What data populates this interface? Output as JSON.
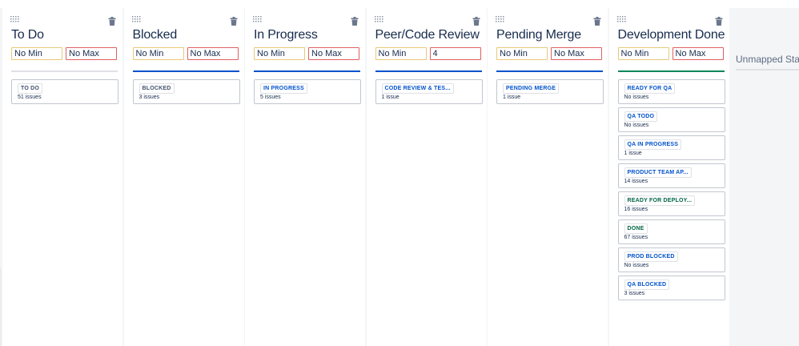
{
  "colors": {
    "board_bg": "#f4f5f7",
    "column_bg": "#ffffff",
    "bar_grey": "#dfe1e6",
    "bar_blue": "#0052cc",
    "bar_green": "#00875a",
    "min_border": "#e8c97a",
    "max_border": "#e06060",
    "lozenge_blue": "#0052cc",
    "lozenge_grey": "#42526e",
    "lozenge_green": "#006644"
  },
  "icons": {
    "drag": "drag-handle-icon",
    "delete": "trash-icon"
  },
  "columns": [
    {
      "title": "To Do",
      "min": "No Min",
      "max": "No Max",
      "bar": "grey",
      "statuses": [
        {
          "name": "TO DO",
          "count": "51 issues",
          "tone": "grey"
        }
      ]
    },
    {
      "title": "Blocked",
      "min": "No Min",
      "max": "No Max",
      "bar": "blue",
      "statuses": [
        {
          "name": "BLOCKED",
          "count": "3 issues",
          "tone": "grey"
        }
      ]
    },
    {
      "title": "In Progress",
      "min": "No Min",
      "max": "No Max",
      "bar": "blue",
      "statuses": [
        {
          "name": "IN PROGRESS",
          "count": "5 issues",
          "tone": "blue"
        }
      ]
    },
    {
      "title": "Peer/Code Review",
      "min": "No Min",
      "max": "4",
      "bar": "blue",
      "statuses": [
        {
          "name": "CODE REVIEW & TES...",
          "count": "1 issue",
          "tone": "blue"
        }
      ]
    },
    {
      "title": "Pending Merge",
      "min": "No Min",
      "max": "No Max",
      "bar": "blue",
      "statuses": [
        {
          "name": "PENDING MERGE",
          "count": "1 issue",
          "tone": "blue"
        }
      ]
    },
    {
      "title": "Development Done",
      "min": "No Min",
      "max": "No Max",
      "bar": "green",
      "statuses": [
        {
          "name": "READY FOR QA",
          "count": "No issues",
          "tone": "blue"
        },
        {
          "name": "QA TODO",
          "count": "No issues",
          "tone": "blue"
        },
        {
          "name": "QA IN PROGRESS",
          "count": "1 issue",
          "tone": "blue"
        },
        {
          "name": "PRODUCT TEAM AP...",
          "count": "14 issues",
          "tone": "blue"
        },
        {
          "name": "READY FOR DEPLOY...",
          "count": "16 issues",
          "tone": "green"
        },
        {
          "name": "DONE",
          "count": "67 issues",
          "tone": "green"
        },
        {
          "name": "PROD BLOCKED",
          "count": "No issues",
          "tone": "blue"
        },
        {
          "name": "QA BLOCKED",
          "count": "3 issues",
          "tone": "blue"
        }
      ]
    }
  ],
  "unmapped": {
    "title": "Unmapped Statuses"
  }
}
